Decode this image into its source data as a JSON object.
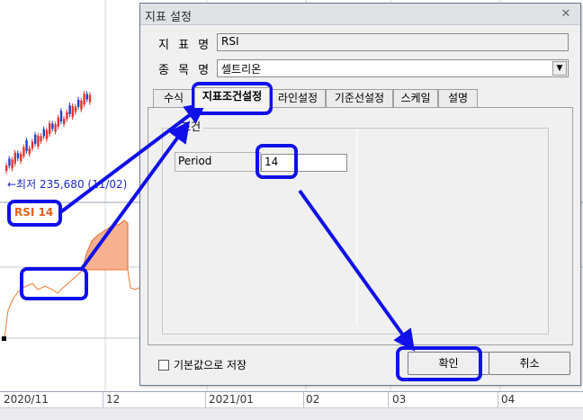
{
  "chart_bg": {
    "min_label": "←최저 235,680 (11/02)",
    "rsi_label": "RSI 14",
    "dates": [
      "2020/11",
      "12",
      "2021/01",
      "02",
      "03",
      "04"
    ]
  },
  "dialog": {
    "title": "지표 설정",
    "close_icon": "close-icon",
    "indicator_name_label": "지 표 명",
    "indicator_name_value": "RSI",
    "item_name_label": "종 목 명",
    "item_name_value": "셀트리온",
    "tabs": [
      "수식",
      "지표조건설정",
      "라인설정",
      "기준선설정",
      "스케일",
      "설명"
    ],
    "active_tab_index": 1,
    "condition_group_title": "조건",
    "period_label": "Period",
    "period_value": "14",
    "save_default_label": "기본값으로 저장",
    "save_default_checked": false,
    "ok_label": "확인",
    "cancel_label": "취소"
  },
  "colors": {
    "annotation": "#1010e8",
    "up_candle": "#e8322e",
    "down_candle": "#1f44c8",
    "rsi_fill": "#f6b08f",
    "rsi_line": "#f07a30"
  }
}
